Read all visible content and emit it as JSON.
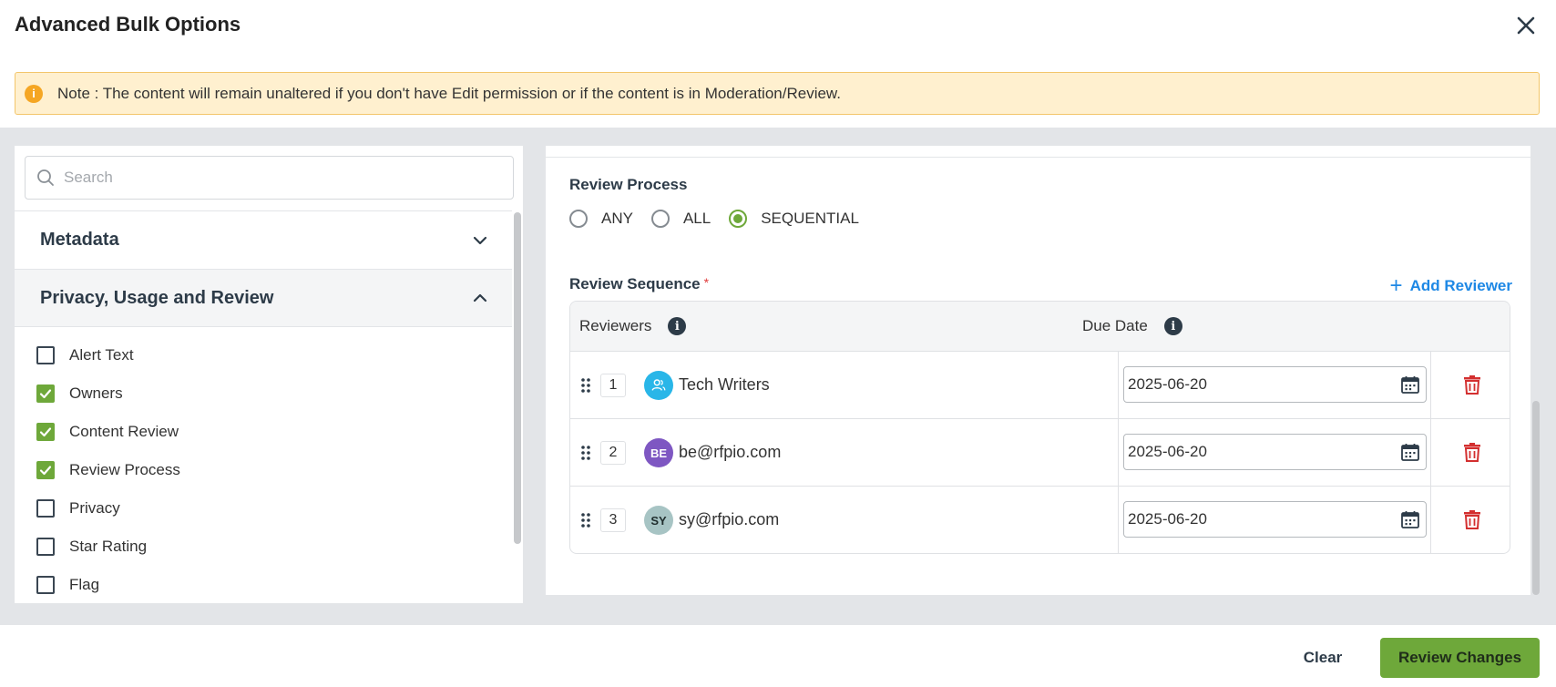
{
  "dialog": {
    "title": "Advanced Bulk Options"
  },
  "note": {
    "icon": "info-icon",
    "text": "Note : The content will remain unaltered if you don't have Edit permission or if the content is in Moderation/Review."
  },
  "sidebar": {
    "search_placeholder": "Search",
    "sections": [
      {
        "label": "Metadata",
        "expanded": false
      },
      {
        "label": "Privacy, Usage and Review",
        "expanded": true
      }
    ],
    "options": [
      {
        "label": "Alert Text",
        "checked": false
      },
      {
        "label": "Owners",
        "checked": true
      },
      {
        "label": "Content Review",
        "checked": true
      },
      {
        "label": "Review Process",
        "checked": true
      },
      {
        "label": "Privacy",
        "checked": false
      },
      {
        "label": "Star Rating",
        "checked": false
      },
      {
        "label": "Flag",
        "checked": false
      }
    ]
  },
  "review_process": {
    "label": "Review Process",
    "options": [
      "ANY",
      "ALL",
      "SEQUENTIAL"
    ],
    "selected": "SEQUENTIAL"
  },
  "review_sequence": {
    "label": "Review Sequence",
    "required_mark": "*",
    "add_label": "Add Reviewer",
    "columns": {
      "reviewers": "Reviewers",
      "due_date": "Due Date"
    },
    "rows": [
      {
        "order": "1",
        "avatar_text": "",
        "avatar_icon": "group-icon",
        "avatar_color": "#29b6e8",
        "name": "Tech Writers",
        "due_date": "2025-06-20"
      },
      {
        "order": "2",
        "avatar_text": "BE",
        "avatar_color": "#7e57c2",
        "name": "be@rfpio.com",
        "due_date": "2025-06-20"
      },
      {
        "order": "3",
        "avatar_text": "SY",
        "avatar_color": "#a7c4c4",
        "name": "sy@rfpio.com",
        "due_date": "2025-06-20"
      }
    ]
  },
  "footer": {
    "clear_label": "Clear",
    "primary_label": "Review Changes"
  },
  "colors": {
    "accent_green": "#6ea83a",
    "link_blue": "#1e88e5",
    "danger_red": "#d32f2f",
    "note_bg": "#fff0cf"
  }
}
